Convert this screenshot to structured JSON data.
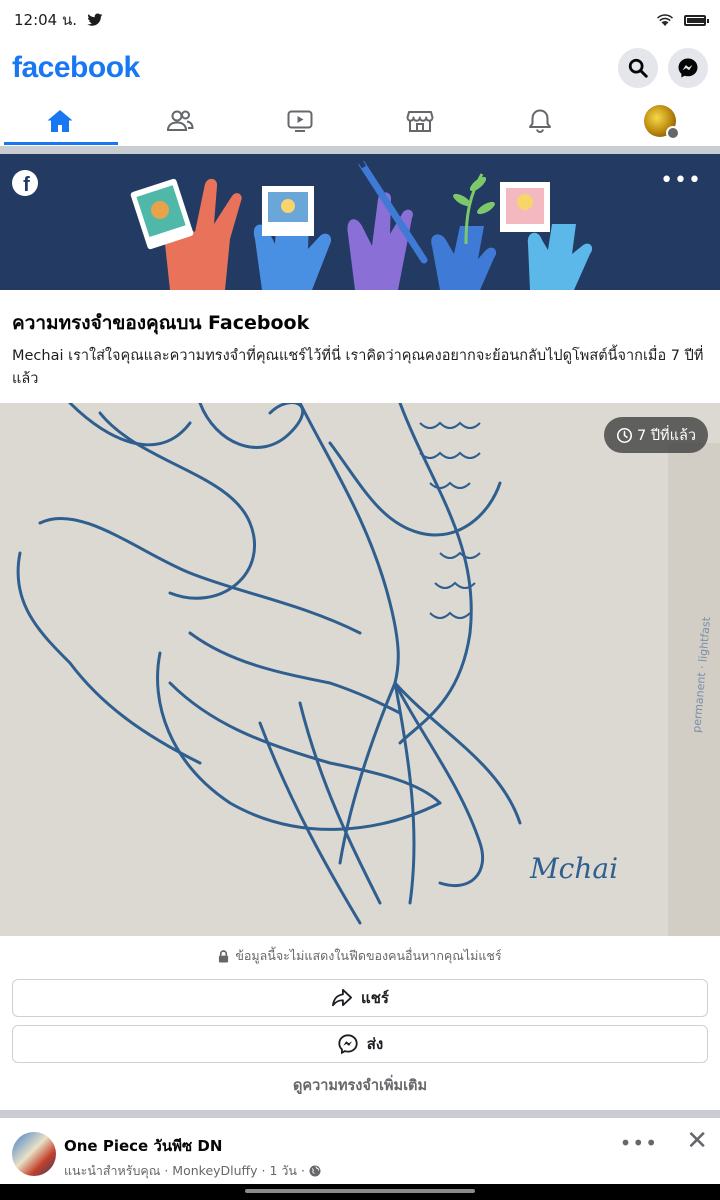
{
  "status_bar": {
    "time": "12:04 น."
  },
  "header": {
    "brand": "facebook"
  },
  "tabs": [
    "home",
    "friends",
    "watch",
    "marketplace",
    "notifications",
    "menu"
  ],
  "memory": {
    "title": "ความทรงจำของคุณบน Facebook",
    "description": "Mechai เราใส่ใจคุณและความทรงจำที่คุณแชร์ไว้ที่นี่ เราคิดว่าคุณคงอยากจะย้อนกลับไปดูโพสต์นี้จากเมื่อ 7 ปีที่แล้ว",
    "age_badge": "7 ปีที่แล้ว",
    "privacy_note": "ข้อมูลนี้จะไม่แสดงในฟีดของคนอื่นหากคุณไม่แชร์",
    "share_label": "แชร์",
    "send_label": "ส่ง",
    "see_more_label": "ดูความทรงจำเพิ่มเติม",
    "signature": "Mchai"
  },
  "next_post": {
    "name": "One Piece วันพีซ DN",
    "meta": "แนะนำสำหรับคุณ · MonkeyDluffy · 1 วัน ·"
  },
  "colors": {
    "accent": "#1877f2",
    "banner": "#233a63"
  }
}
